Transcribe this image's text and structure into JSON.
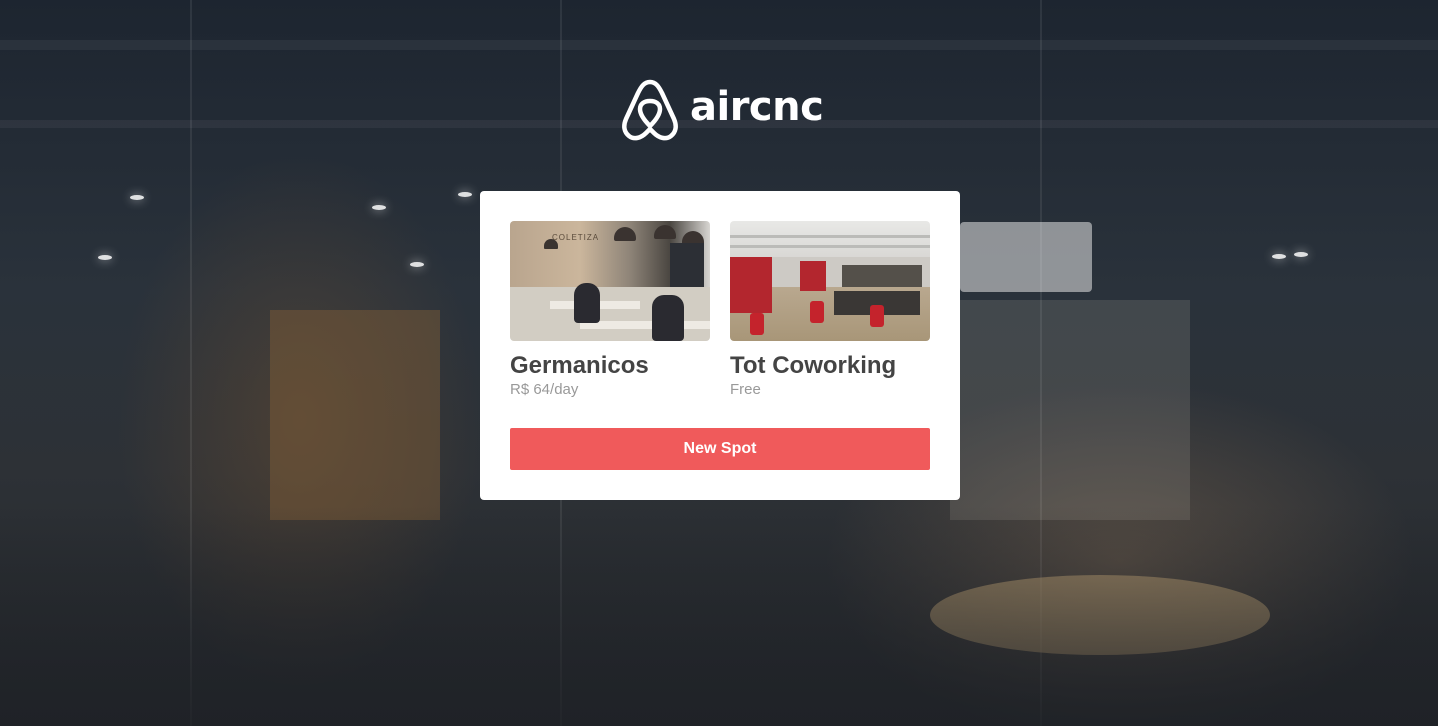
{
  "app": {
    "logo_text": "aircnc",
    "logo_icon": "airbnb-belo-icon"
  },
  "spots": [
    {
      "name": "Germanicos",
      "price": "R$ 64/day",
      "thumbnail_sign": "COLETIZA"
    },
    {
      "name": "Tot Coworking",
      "price": "Free"
    }
  ],
  "actions": {
    "new_spot_label": "New Spot"
  },
  "colors": {
    "accent": "#f05a5b",
    "card_background": "#ffffff",
    "title_text": "#444444",
    "price_text": "#999999"
  }
}
